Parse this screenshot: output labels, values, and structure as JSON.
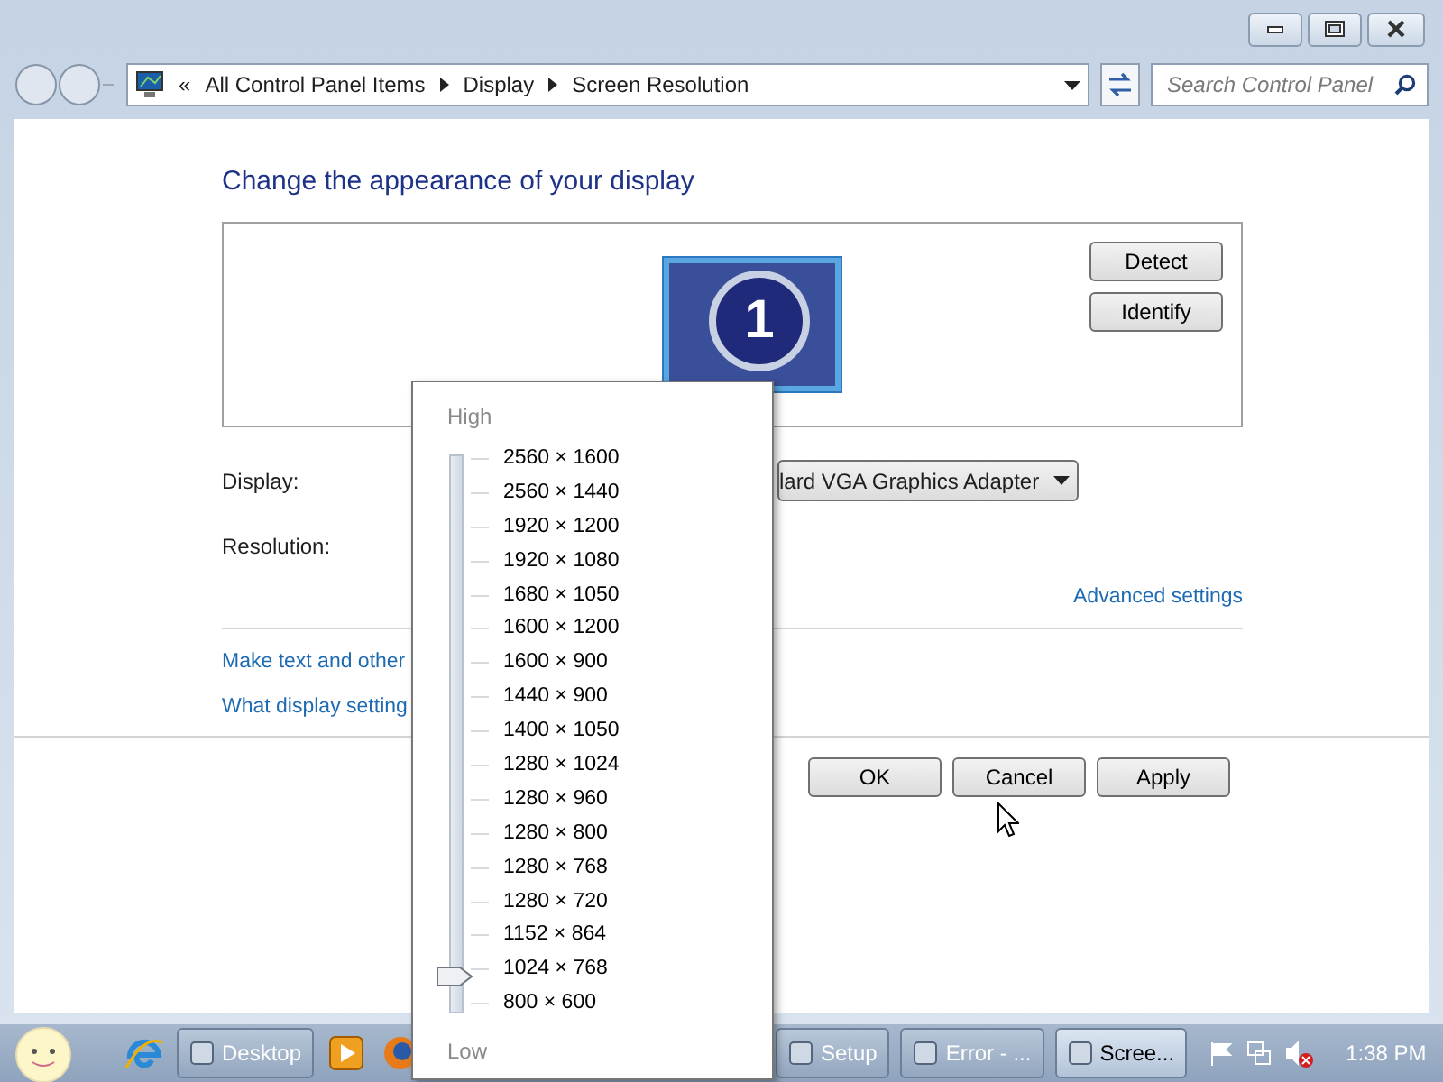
{
  "address_bar": {
    "chevron": "«",
    "crumbs": [
      "All Control Panel Items",
      "Display",
      "Screen Resolution"
    ]
  },
  "search": {
    "placeholder": "Search Control Panel"
  },
  "heading": "Change the appearance of your display",
  "monitor": {
    "number": "1"
  },
  "side_buttons": [
    "Detect",
    "Identify"
  ],
  "fields": [
    {
      "label": "Display:",
      "value": "lard VGA Graphics Adapter"
    },
    {
      "label": "Resolution:"
    }
  ],
  "advanced_link": "Advanced settings",
  "links": [
    "Make text and other",
    "What display setting"
  ],
  "buttons": [
    "OK",
    "Cancel",
    "Apply"
  ],
  "resolution_popup": {
    "high": "High",
    "low": "Low",
    "level": 0.0625,
    "options": [
      "2560 × 1600",
      "2560 × 1440",
      "1920 × 1200",
      "1920 × 1080",
      "1680 × 1050",
      "1600 × 1200",
      "1600 × 900",
      "1440 × 900",
      "1400 × 1050",
      "1280 × 1024",
      "1280 × 960",
      "1280 × 800",
      "1280 × 768",
      "1280 × 720",
      "1152 × 864",
      "1024 × 768",
      "800 × 600"
    ]
  },
  "taskbar": {
    "items": [
      {
        "kind": "browser"
      },
      {
        "kind": "label",
        "label": "Desktop",
        "selected": false
      },
      {
        "kind": "media"
      },
      {
        "kind": "firefox"
      },
      {
        "kind": "label",
        "label": "Setup",
        "selected": false
      },
      {
        "kind": "label",
        "label": "Error - ...",
        "selected": false
      },
      {
        "kind": "label",
        "label": "Scree...",
        "selected": true
      }
    ],
    "clock": "1:38 PM"
  }
}
